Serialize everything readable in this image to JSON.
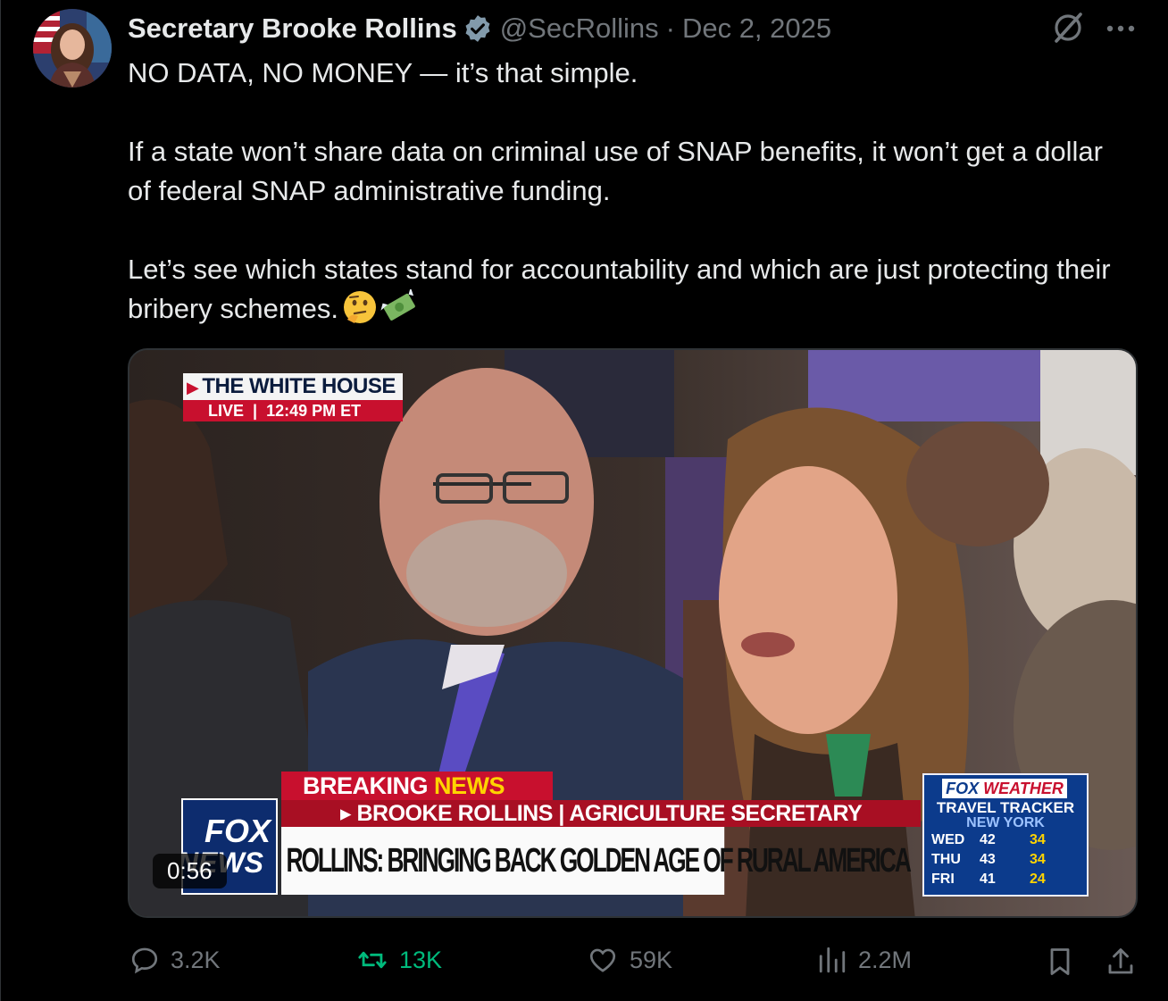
{
  "author": {
    "display_name": "Secretary Brooke Rollins",
    "handle": "@SecRollins",
    "separator": "·",
    "date": "Dec 2, 2025"
  },
  "tweet": {
    "line1": "NO DATA, NO MONEY — it’s that simple.",
    "line2": "If a state won’t share data on criminal use of SNAP benefits, it won’t get a dollar of federal SNAP administrative funding.",
    "line3": "Let’s see which states stand for accountability and which are just protecting their bribery schemes.",
    "emojis": "🤔💸"
  },
  "video": {
    "duration": "0:56",
    "wh_bug_title": "THE WHITE HOUSE",
    "wh_bug_live": "LIVE",
    "wh_bug_time": "12:49 PM ET",
    "breaking_part1": "BREAKING",
    "breaking_part2": "NEWS",
    "subbar": "▸ BROOKE ROLLINS | AGRICULTURE SECRETARY",
    "headline": "ROLLINS: BRINGING BACK GOLDEN AGE OF RURAL AMERICA",
    "logo_line1": "FOX",
    "logo_line2": "NEWS",
    "weather": {
      "brand_fox": "FOX",
      "brand_weather": "WEATHER",
      "title": "TRAVEL TRACKER",
      "location": "NEW YORK",
      "rows": [
        {
          "day": "WED",
          "hi": "42",
          "lo": "34"
        },
        {
          "day": "THU",
          "hi": "43",
          "lo": "34"
        },
        {
          "day": "FRI",
          "hi": "41",
          "lo": "24"
        }
      ]
    }
  },
  "actions": {
    "replies": "3.2K",
    "reposts": "13K",
    "likes": "59K",
    "views": "2.2M"
  },
  "colors": {
    "background": "#000000",
    "text": "#e7e9ea",
    "muted": "#71767b",
    "repost_active": "#00ba7c",
    "verified": "#829aab",
    "fox_red": "#c8102e",
    "fox_blue": "#0d2c6e"
  }
}
